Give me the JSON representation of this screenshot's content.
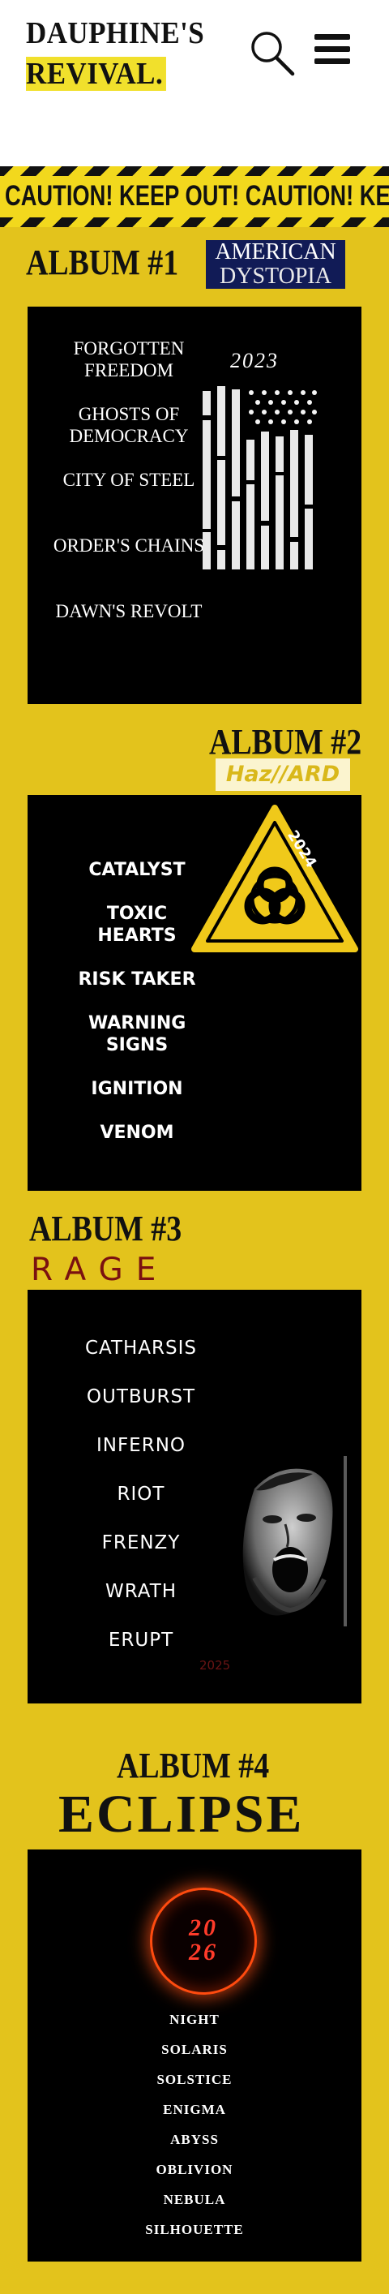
{
  "header": {
    "logo_line1": "DAUPHINE'S",
    "logo_line2": "REVIVAL.",
    "search_icon": "search-icon",
    "menu_icon": "hamburger-menu-icon"
  },
  "banner": {
    "text": "CAUTION! KEEP OUT!  CAUTION! KEEP OUT!"
  },
  "albums": [
    {
      "title": "ALBUM #1",
      "name_line1": "AMERICAN",
      "name_line2": "DYSTOPIA",
      "year": "2023",
      "art_icon": "distressed-american-flag-icon",
      "tracks": [
        "FORGOTTEN FREEDOM",
        "GHOSTS OF DEMOCRACY",
        "CITY OF STEEL",
        "ORDER'S CHAINS",
        "DAWN'S REVOLT"
      ]
    },
    {
      "title": "ALBUM #2",
      "name": "Haz//ARD",
      "year": "2024",
      "art_icon": "biohazard-warning-icon",
      "tracks": [
        "CATALYST",
        "TOXIC HEARTS",
        "RISK TAKER",
        "WARNING SIGNS",
        "IGNITION",
        "VENOM"
      ]
    },
    {
      "title": "ALBUM #3",
      "name": "RAGE",
      "year": "2025",
      "art_icon": "screaming-face-icon",
      "tracks": [
        "CATHARSIS",
        "OUTBURST",
        "INFERNO",
        "RIOT",
        "FRENZY",
        "WRATH",
        "ERUPT"
      ]
    },
    {
      "title": "ALBUM #4",
      "name": "ECLIPSE",
      "year_line1": "20",
      "year_line2": "26",
      "art_icon": "solar-eclipse-ring-icon",
      "tracks": [
        "NIGHT",
        "SOLARIS",
        "SOLSTICE",
        "ENIGMA",
        "ABYSS",
        "OBLIVION",
        "NEBULA",
        "SILHOUETTE"
      ]
    }
  ],
  "colors": {
    "page_background": "#e3c31c",
    "logo_highlight": "#f1e02c",
    "album1_badge": "#111b56",
    "rage_red": "#7a1110",
    "eclipse_orange": "#ff4b0f"
  }
}
